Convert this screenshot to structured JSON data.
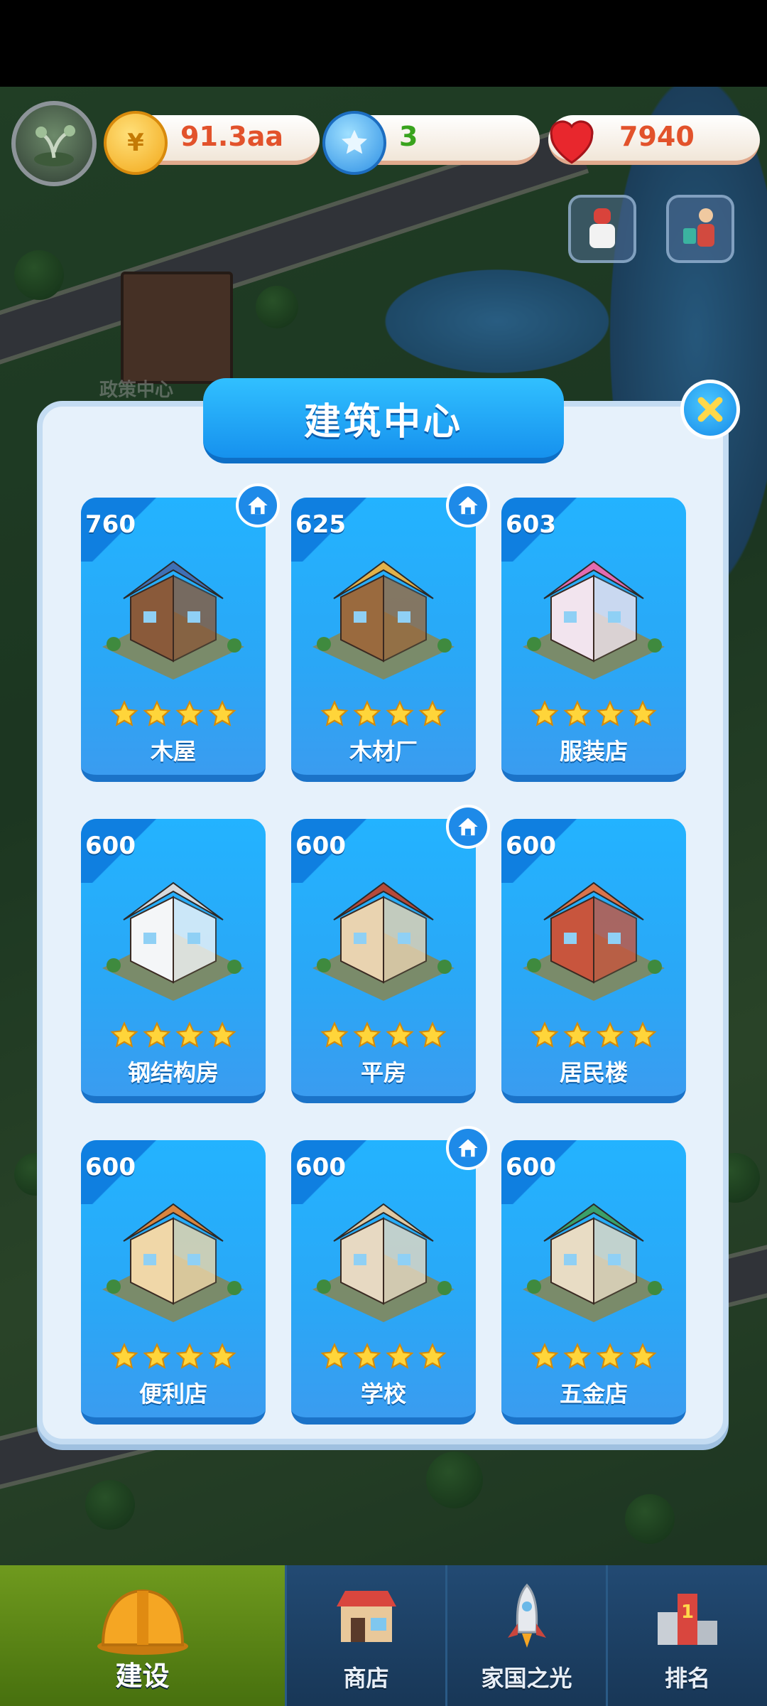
{
  "hud": {
    "coins": "91.3aa",
    "stars": "3",
    "hearts": "7940",
    "coin_symbol": "¥"
  },
  "background": {
    "label": "政策中心"
  },
  "modal": {
    "title": "建筑中心"
  },
  "buildings": [
    {
      "cost": "760",
      "name": "木屋",
      "stars": 4,
      "home": true
    },
    {
      "cost": "625",
      "name": "木材厂",
      "stars": 4,
      "home": true
    },
    {
      "cost": "603",
      "name": "服装店",
      "stars": 4,
      "home": false
    },
    {
      "cost": "600",
      "name": "钢结构房",
      "stars": 4,
      "home": false
    },
    {
      "cost": "600",
      "name": "平房",
      "stars": 4,
      "home": true
    },
    {
      "cost": "600",
      "name": "居民楼",
      "stars": 4,
      "home": false
    },
    {
      "cost": "600",
      "name": "便利店",
      "stars": 4,
      "home": false
    },
    {
      "cost": "600",
      "name": "学校",
      "stars": 4,
      "home": true
    },
    {
      "cost": "600",
      "name": "五金店",
      "stars": 4,
      "home": false
    }
  ],
  "nav": {
    "tabs": [
      {
        "label": "建设",
        "icon": "hard-hat-icon"
      },
      {
        "label": "商店",
        "icon": "shop-icon"
      },
      {
        "label": "家国之光",
        "icon": "rocket-icon"
      },
      {
        "label": "排名",
        "icon": "ranking-icon"
      }
    ]
  },
  "colors": {
    "accent": "#1f96f0",
    "coin_text": "#e2522b",
    "star_text": "#39a31d",
    "heart_text": "#e2522b",
    "active_tab": "#5c8a17"
  }
}
